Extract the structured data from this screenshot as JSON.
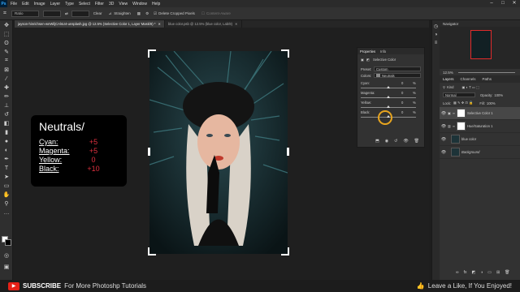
{
  "app": {
    "logo": "Ps"
  },
  "menu": [
    "File",
    "Edit",
    "Image",
    "Layer",
    "Type",
    "Select",
    "Filter",
    "3D",
    "View",
    "Window",
    "Help"
  ],
  "options": {
    "ratio": "Ratio",
    "clear": "Clear",
    "straighten": "Straighten",
    "delete_cropped": "Delete Cropped Pixels",
    "content_aware": "Content-Aware"
  },
  "tabs": [
    {
      "label": "jayson-hinrichsen-wnWiljCAlsU4-unsplash.jpg @ 12.5% (Selective Color 1, Layer Mask/8) *"
    },
    {
      "label": "blue color.psb @ 12.5% (blue color, Lab/8)"
    }
  ],
  "note": {
    "title": "Neutrals/",
    "rows": [
      {
        "label": "Cyan:",
        "value": "+5"
      },
      {
        "label": "Magenta:",
        "value": "+5"
      },
      {
        "label": "Yellow:",
        "value": "0"
      },
      {
        "label": "Black:",
        "value": "+10"
      }
    ]
  },
  "properties": {
    "tab1": "Properties",
    "tab2": "Info",
    "panel_title": "Selective Color",
    "preset_label": "Preset:",
    "preset_value": "Custom",
    "colors_label": "Colors:",
    "colors_value": "Neutrals",
    "sliders": [
      {
        "name": "Cyan:",
        "value": "0",
        "unit": "%",
        "level": 0.5
      },
      {
        "name": "Magenta:",
        "value": "0",
        "unit": "%",
        "level": 0.5
      },
      {
        "name": "Yellow:",
        "value": "0",
        "unit": "%",
        "level": 0.5
      },
      {
        "name": "Black:",
        "value": "0",
        "unit": "%",
        "level": 0.5
      }
    ]
  },
  "navigator": {
    "title": "Navigator",
    "zoom": "12.5%"
  },
  "layers": {
    "tabs": [
      "Layers",
      "Channels",
      "Paths"
    ],
    "kind": "Kind",
    "mode": "Normal",
    "opacity_label": "Opacity:",
    "opacity_value": "100%",
    "lock_label": "Lock:",
    "fill_label": "Fill:",
    "fill_value": "100%",
    "items": [
      {
        "name": "Selective Color 1",
        "selected": true
      },
      {
        "name": "Hue/Saturation 1",
        "selected": false
      },
      {
        "name": "blue color",
        "selected": false
      },
      {
        "name": "Background",
        "selected": false
      }
    ]
  },
  "footer": {
    "subscribe": "SUBSCRIBE",
    "more": "For More Photoshp Tutorials",
    "like": "Leave  a Like, If You Enjoyed!"
  },
  "colors": {
    "accent_red": "#e0313f",
    "highlight": "#e8a51f"
  }
}
